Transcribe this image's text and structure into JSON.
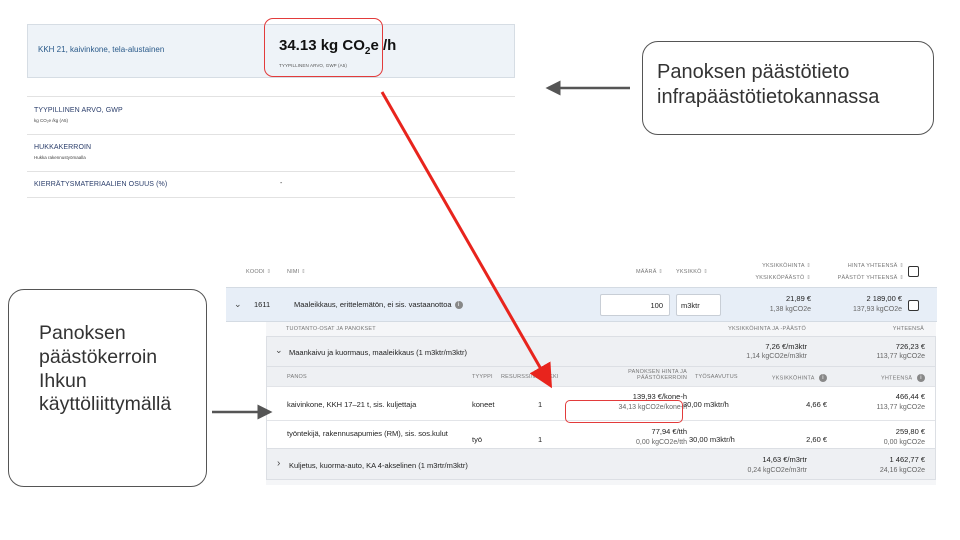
{
  "database": {
    "item_name": "KKH 21, kaivinkone, tela-alustainen",
    "value_prefix": "34.13 kg CO",
    "value_subscript": "2",
    "value_suffix": "e /h",
    "value_caption": "TYYPILLINEN ARVO, GWP (A5)",
    "rows": [
      {
        "title": "TYYPILLINEN ARVO, GWP",
        "subtitle": "kg CO₂e /kg (A5)",
        "value": ""
      },
      {
        "title": "HUKKAKERROIN",
        "subtitle": "Hukka rakennustyömaalla",
        "value": ""
      },
      {
        "title": "KIERRÄTYSMATERIAALIEN OSUUS (%)",
        "subtitle": "",
        "value": "-"
      }
    ]
  },
  "callouts": {
    "top": "Panoksen päästötieto infrapäästötietokannassa",
    "left": "Panoksen päästökerroin Ihkun käyttöliittymällä"
  },
  "table": {
    "headers": {
      "code": "KOODI",
      "name": "NIMI",
      "amount": "MÄÄRÄ",
      "unit": "YKSIKKÖ",
      "unit_price": "YKSIKKÖHINTA",
      "unit_emission": "YKSIKKÖPÄÄSTÖ",
      "total_price": "HINTA YHTEENSÄ",
      "total_emission": "PÄÄSTÖT YHTEENSÄ",
      "sort": "⇕"
    },
    "main_row": {
      "code": "1611",
      "name": "Maaleikkaus, erittelemätön, ei sis. vastaanottoa",
      "amount": "100",
      "unit": "m3ktr",
      "unit_price": "21,89 €",
      "unit_emission": "1,38 kgCO2e",
      "total_price": "2 189,00 €",
      "total_emission": "137,93 kgCO2e"
    },
    "sub_headers": {
      "left": "TUOTANTO-OSAT JA PANOKSET",
      "mid": "YKSIKKÖHINTA JA -PÄÄSTÖ",
      "right": "YHTEENSÄ"
    },
    "group1": {
      "name": "Maankaivu ja kuormaus, maaleikkaus (1 m3ktr/m3ktr)",
      "unit_price": "7,26 €/m3ktr",
      "unit_emission": "1,14 kgCO2e/m3ktr",
      "total_price": "726,23 €",
      "total_emission": "113,77 kgCO2e"
    },
    "inner_headers": {
      "input": "PANOS",
      "type": "TYYPPI",
      "resource": "RESURSSI/MENEKKI",
      "price_line1": "PANOKSEN HINTA JA",
      "price_line2": "PÄÄSTÖKERROIN",
      "output": "TYÖSAAVUTUS",
      "unit_price": "YKSIKKÖHINTA",
      "total": "YHTEENSÄ"
    },
    "resources": [
      {
        "name": "kaivinkone, KKH 17–21 t, sis. kuljettaja",
        "type": "koneet",
        "qty": "1",
        "price": "139,93 €/kone-h",
        "factor": "34,13 kgCO2e/kone-h",
        "output": "30,00 m3ktr/h",
        "unit_price": "4,66 €",
        "total_price": "466,44 €",
        "total_emission": "113,77 kgCO2e"
      },
      {
        "name": "työntekijä, rakennusapumies (RM), sis. sos.kulut",
        "type": "työ",
        "qty": "1",
        "price": "77,94 €/tth",
        "factor": "0,00 kgCO2e/tth",
        "output": "30,00 m3ktr/h",
        "unit_price": "2,60 €",
        "total_price": "259,80 €",
        "total_emission": "0,00 kgCO2e"
      }
    ],
    "group2": {
      "name": "Kuljetus, kuorma-auto, KA 4-akselinen (1 m3rtr/m3ktr)",
      "unit_price": "14,63 €/m3rtr",
      "unit_emission": "0,24 kgCO2e/m3rtr",
      "total_price": "1 462,77 €",
      "total_emission": "24,16 kgCO2e"
    }
  },
  "colors": {
    "highlight": "#e23b3b",
    "arrow": "#e8241d",
    "pointer": "#555555"
  },
  "icons": {
    "info": "info-icon",
    "chevron_down": "chevron-down-icon",
    "chevron_right": "chevron-right-icon"
  }
}
